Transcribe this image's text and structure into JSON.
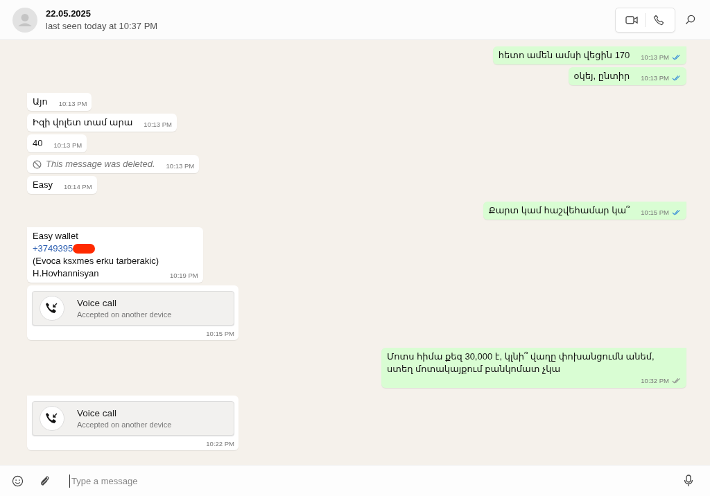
{
  "header": {
    "contact_name": "22.05.2025",
    "status": "last seen today at 10:37 PM"
  },
  "messages": [
    {
      "kind": "text",
      "outgoing": true,
      "text": "հետո ամեն ամսի վեցին 170",
      "time": "10:13 PM",
      "read": true
    },
    {
      "kind": "text",
      "outgoing": true,
      "text": "օկեյ, ընտիր",
      "time": "10:13 PM",
      "read": true
    },
    {
      "kind": "text",
      "outgoing": false,
      "text": "Այո",
      "time": "10:13 PM"
    },
    {
      "kind": "text",
      "outgoing": false,
      "text": "Իզի վոլետ տամ արա",
      "time": "10:13 PM"
    },
    {
      "kind": "text",
      "outgoing": false,
      "text": "40",
      "time": "10:13 PM"
    },
    {
      "kind": "deleted",
      "outgoing": false,
      "text": "This message was deleted.",
      "time": "10:13 PM"
    },
    {
      "kind": "text",
      "outgoing": false,
      "text": "Easy",
      "time": "10:14 PM"
    },
    {
      "kind": "text",
      "outgoing": true,
      "text": "Քարտ կամ հաշվեհամար կա՞",
      "time": "10:15 PM",
      "read": true
    },
    {
      "kind": "contact",
      "outgoing": false,
      "lines": [
        "Easy wallet",
        "(Evoca ksxmes erku tarberakic)",
        "H.Hovhannisyan"
      ],
      "link": "+3749395",
      "time": "10:19 PM"
    },
    {
      "kind": "call",
      "outgoing": false,
      "title": "Voice call",
      "subtitle": "Accepted on another device",
      "time": "10:15 PM"
    },
    {
      "kind": "text",
      "outgoing": true,
      "text": "Մոտս հիմա քեզ 30,000  է, կլնի՞ վաղը փոխանցումն անեմ, ստեղ մոտակայքում բանկոմատ չկա",
      "time": "10:32 PM",
      "read": false
    },
    {
      "kind": "call",
      "outgoing": false,
      "title": "Voice call",
      "subtitle": "Accepted on another device",
      "time": "10:22 PM"
    }
  ],
  "composer": {
    "placeholder": "Type a message"
  }
}
